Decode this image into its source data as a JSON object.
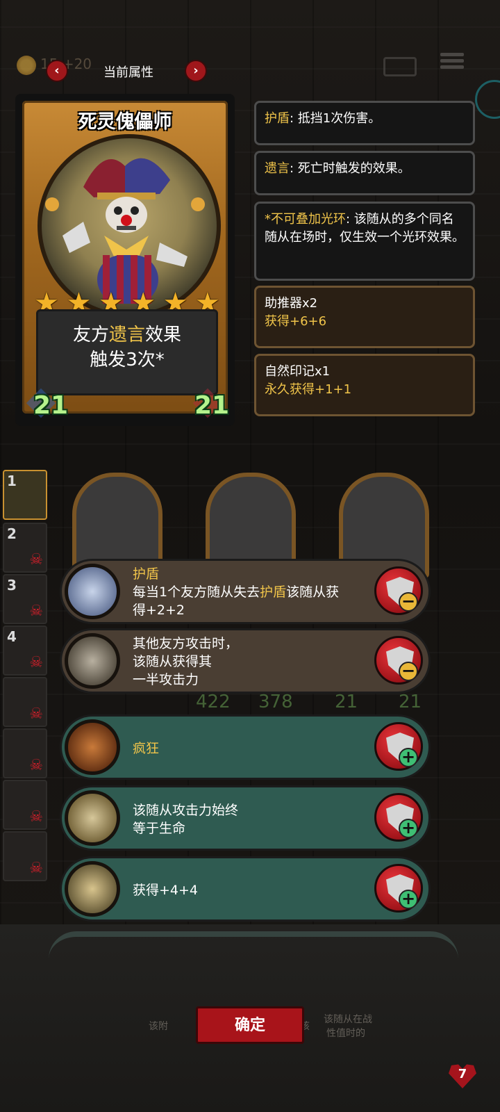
{
  "topbar": {
    "title": "当前属性",
    "gold": "15",
    "gold_income": "+20"
  },
  "card": {
    "name": "死灵傀儡师",
    "stars": 6,
    "text_line1_pre": "友方",
    "text_line1_hl": "遗言",
    "text_line1_post": "效果",
    "text_line2": "触发3次*",
    "attack": "21",
    "health": "21"
  },
  "info_panels": [
    {
      "key": "护盾",
      "text": ": 抵挡1次伤害。"
    },
    {
      "key": "遗言",
      "text": ": 死亡时触发的效果。"
    },
    {
      "key": "*不可叠加光环",
      "text": ": 该随从的多个同名随从在场时，仅生效一个光环效果。"
    },
    {
      "title": "助推器x2",
      "sub": "获得+6+6"
    },
    {
      "title": "自然印记x1",
      "sub": "永久获得+1+1"
    }
  ],
  "board": {
    "values": [
      "422",
      "378",
      "21",
      "21"
    ]
  },
  "left_list": [
    "1",
    "2",
    "3",
    "4"
  ],
  "skills": [
    {
      "title": "护盾",
      "line1_pre": "每当1个友方随从失去",
      "line1_hl": "护盾",
      "line1_post": "该随从获",
      "line2": "得+2+2",
      "state": "owned",
      "icon": "shield-orb-icon"
    },
    {
      "line1": "其他友方攻击时，",
      "line2": "该随从获得其",
      "line3": "一半攻击力",
      "state": "owned",
      "icon": "staff-icon"
    },
    {
      "title": "疯狂",
      "state": "available",
      "icon": "horn-icon"
    },
    {
      "line1": "该随从攻击力始终",
      "line2": "等于生命",
      "state": "available",
      "icon": "scales-icon"
    },
    {
      "line1": "获得+4+4",
      "state": "available",
      "icon": "bat-icon"
    }
  ],
  "bottom": {
    "confirm": "确定",
    "faded_left": "该附",
    "faded_mid": "该",
    "faded_right1": "该随从在战",
    "faded_right2": "性值时的",
    "heart": "7"
  },
  "colors": {
    "highlight": "#f0c44a",
    "owned_row": "#4a3e33",
    "available_row": "#2f5b51",
    "button_red": "#a8141a",
    "stat_green": "#b5f28c"
  }
}
